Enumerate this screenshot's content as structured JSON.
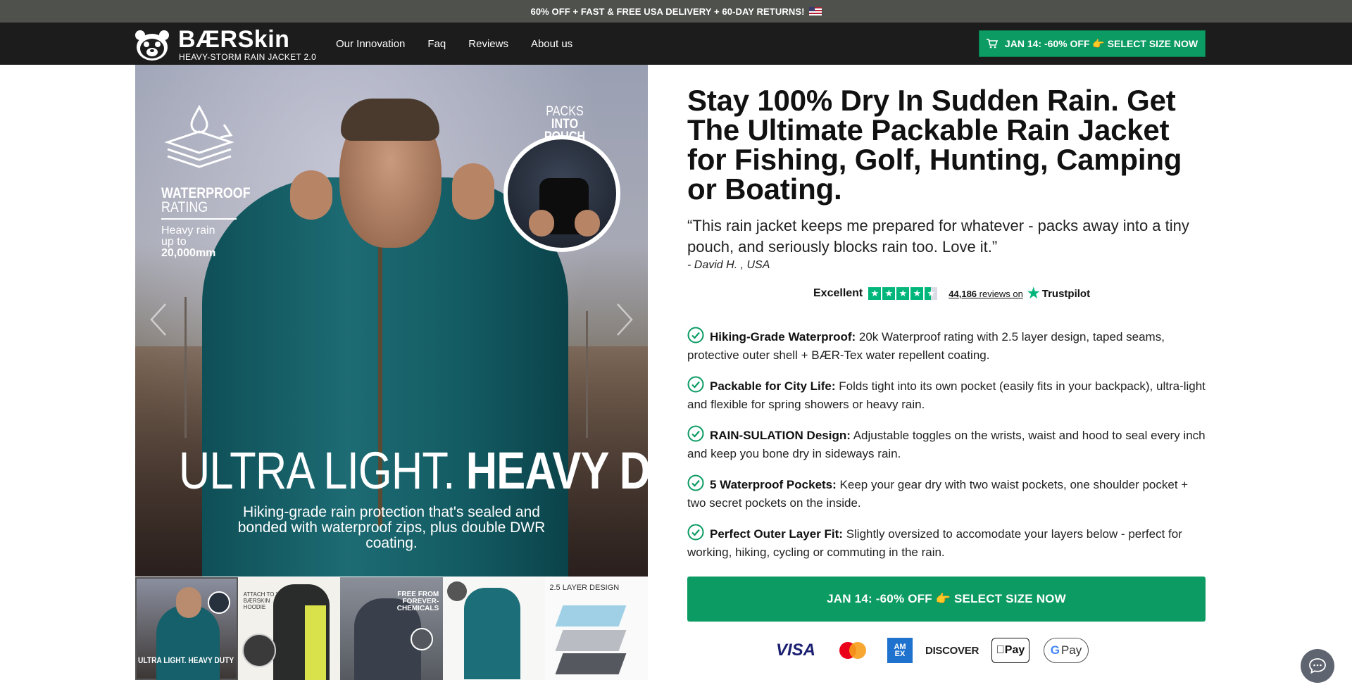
{
  "promo_bar": {
    "text": "60% OFF + FAST & FREE USA DELIVERY + 60-DAY RETURNS!",
    "flag_icon": "us-flag-icon"
  },
  "navbar": {
    "brand": "BÆRSkin",
    "brand_sub": "HEAVY-STORM RAIN JACKET 2.0",
    "links": [
      "Our Innovation",
      "Faq",
      "Reviews",
      "About us"
    ],
    "cta_label": "JAN 14: -60% OFF 👉 SELECT SIZE NOW",
    "cta_icon": "cart-icon",
    "cta_color": "#0c9b63"
  },
  "gallery": {
    "main": {
      "waterproof_title": "WATERPROOF",
      "waterproof_title2": "RATING",
      "waterproof_line1": "Heavy rain",
      "waterproof_line2": "up to",
      "waterproof_value": "20,000mm",
      "packs_line1": "PACKS",
      "packs_line2": "INTO POUCH",
      "headline_light": "ULTRA LIGHT.",
      "headline_bold": "HEAVY DUTY",
      "caption": "Hiking-grade rain protection that's sealed and bonded with waterproof zips, plus double DWR coating."
    },
    "thumbnails": [
      {
        "caption_light": "ULTRA LIGHT.",
        "caption_bold": "HEAVY DUTY",
        "active": true
      },
      {
        "caption": "ATTACH TO YOUR BÆRSKIN HOODIE"
      },
      {
        "caption_light": "FREE FROM",
        "caption_bold": "FOREVER-CHEMICALS"
      },
      {
        "caption": ""
      },
      {
        "caption": "2.5 LAYER DESIGN"
      }
    ]
  },
  "product": {
    "title": "Stay 100% Dry In Sudden Rain. Get The Ultimate Packable Rain Jacket for Fishing, Golf, Hunting, Camping or Boating.",
    "quote": "“This rain jacket keeps me prepared for whatever - packs away into a tiny pouch, and seriously blocks rain too. Love it.”",
    "quote_author": "- David H. , USA",
    "trustpilot": {
      "rating_word": "Excellent",
      "stars": 4.5,
      "review_count": "44,186",
      "reviews_on": "reviews on",
      "brand": "Trustpilot",
      "color": "#00b67a"
    },
    "features": [
      {
        "title": "Hiking-Grade Waterproof:",
        "text": "20k Waterproof rating with 2.5 layer design, taped seams, protective outer shell + BÆR-Tex water repellent coating."
      },
      {
        "title": "Packable for City Life:",
        "text": "Folds tight into its own pocket (easily fits in your backpack), ultra-light and flexible for spring showers or heavy rain."
      },
      {
        "title": "RAIN-SULATION Design:",
        "text": "Adjustable toggles on the wrists, waist and hood to seal every inch and keep you bone dry in sideways rain."
      },
      {
        "title": "5 Waterproof Pockets:",
        "text": "Keep your gear dry with two waist pockets, one shoulder pocket + two secret pockets on the inside."
      },
      {
        "title": "Perfect Outer Layer Fit:",
        "text": "Slightly oversized to accomodate your layers below - perfect for working, hiking, cycling or commuting in the rain."
      }
    ],
    "cta_label": "JAN 14: -60% OFF 👉 SELECT SIZE NOW",
    "payments": {
      "visa": "VISA",
      "amex_top": "AM",
      "amex_bottom": "EX",
      "discover": "DISCOVER",
      "applepay": "Pay",
      "gpay_g": "G",
      "gpay": "Pay"
    }
  },
  "chat": {
    "icon": "chat-icon"
  }
}
